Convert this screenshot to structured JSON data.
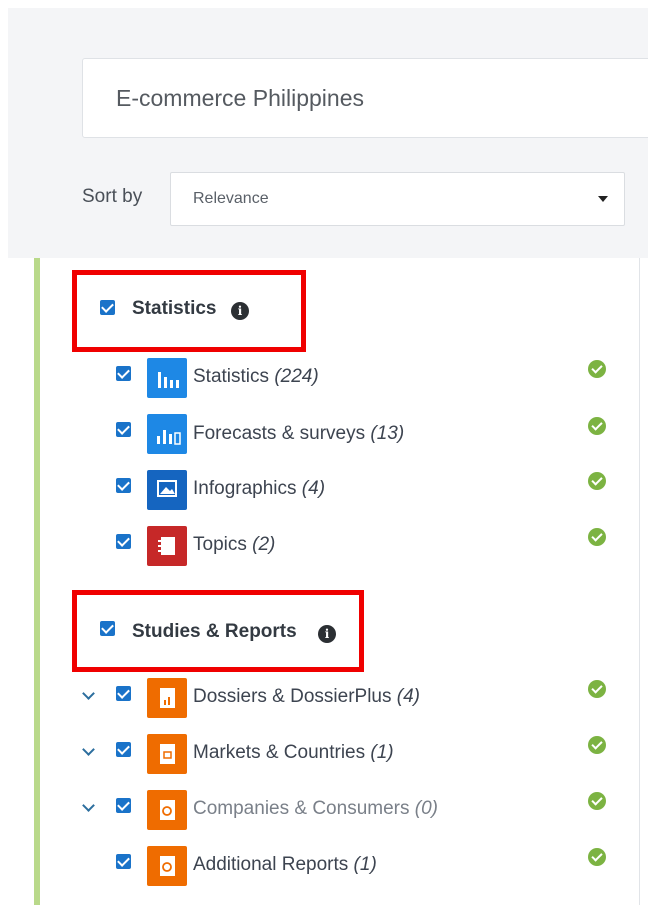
{
  "search": {
    "value": "E-commerce Philippines"
  },
  "sort": {
    "label": "Sort by",
    "selected": "Relevance"
  },
  "groups": [
    {
      "title": "Statistics",
      "checked": true,
      "items": [
        {
          "label": "Statistics",
          "count": "(224)",
          "icon": "bar-chart-icon",
          "color": "#1e88e5",
          "checked": true,
          "available": true
        },
        {
          "label": "Forecasts & surveys",
          "count": "(13)",
          "icon": "forecast-chart-icon",
          "color": "#1e88e5",
          "checked": true,
          "available": true
        },
        {
          "label": "Infographics",
          "count": "(4)",
          "icon": "image-icon",
          "color": "#1565c0",
          "checked": true,
          "available": true
        },
        {
          "label": "Topics",
          "count": "(2)",
          "icon": "notebook-icon",
          "color": "#c62828",
          "checked": true,
          "available": true
        }
      ]
    },
    {
      "title": "Studies & Reports",
      "checked": true,
      "items": [
        {
          "label": "Dossiers & DossierPlus",
          "count": "(4)",
          "icon": "dossier-icon",
          "color": "#ef6c00",
          "checked": true,
          "available": true,
          "expandable": true
        },
        {
          "label": "Markets & Countries",
          "count": "(1)",
          "icon": "market-report-icon",
          "color": "#ef6c00",
          "checked": true,
          "available": true,
          "expandable": true
        },
        {
          "label": "Companies & Consumers",
          "count": "(0)",
          "icon": "company-report-icon",
          "color": "#ef6c00",
          "checked": true,
          "available": true,
          "expandable": true
        },
        {
          "label": "Additional Reports",
          "count": "(1)",
          "icon": "report-icon",
          "color": "#ef6c00",
          "checked": true,
          "available": true
        }
      ]
    }
  ],
  "colors": {
    "accent": "#1a73c9",
    "highlight": "#f00000",
    "ok": "#7cb342",
    "panel_bar": "#b9d98a"
  }
}
